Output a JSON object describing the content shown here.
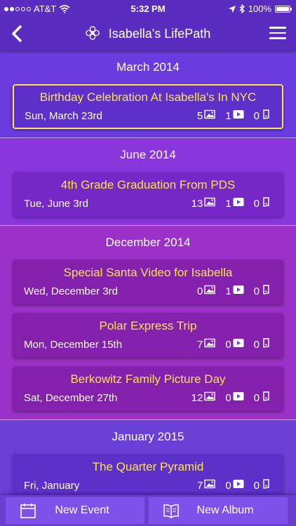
{
  "status_bar": {
    "carrier": "AT&T",
    "time": "5:32 PM",
    "battery": "100%"
  },
  "header": {
    "title": "Isabella's LifePath"
  },
  "sections": [
    {
      "month": "March 2014",
      "background": "#6a3ce0",
      "events": [
        {
          "title": "Birthday Celebration At Isabella's In NYC",
          "date": "Sun, March 23rd",
          "photos": "5",
          "videos": "1",
          "notes": "0",
          "card_color": "#5c30c9",
          "selected": true
        }
      ]
    },
    {
      "month": "June 2014",
      "background": "#8a36dd",
      "events": [
        {
          "title": "4th Grade Graduation From PDS",
          "date": "Tue, June 3rd",
          "photos": "13",
          "videos": "1",
          "notes": "0",
          "card_color": "#7528c6",
          "selected": false
        }
      ]
    },
    {
      "month": "December 2014",
      "background": "#9b31c8",
      "events": [
        {
          "title": "Special Santa Video for Isabella",
          "date": "Wed, December 3rd",
          "photos": "0",
          "videos": "1",
          "notes": "0",
          "card_color": "#8321ad",
          "selected": false
        },
        {
          "title": "Polar Express Trip",
          "date": "Mon, December 15th",
          "photos": "7",
          "videos": "0",
          "notes": "0",
          "card_color": "#8321ad",
          "selected": false
        },
        {
          "title": "Berkowitz Family Picture Day",
          "date": "Sat, December 27th",
          "photos": "12",
          "videos": "0",
          "notes": "0",
          "card_color": "#8321ad",
          "selected": false
        }
      ]
    },
    {
      "month": "January 2015",
      "background": "#6a3fd6",
      "events": [
        {
          "title": "The Quarter Pyramid",
          "date": "Fri, January",
          "photos": "7",
          "videos": "0",
          "notes": "0",
          "card_color": "#5c30c9",
          "selected": false
        }
      ]
    }
  ],
  "bottom_bar": {
    "new_event_label": "New Event",
    "new_album_label": "New Album"
  },
  "colors": {
    "accent_yellow": "#ffe44d",
    "nav_purple": "#5a2cc0"
  }
}
